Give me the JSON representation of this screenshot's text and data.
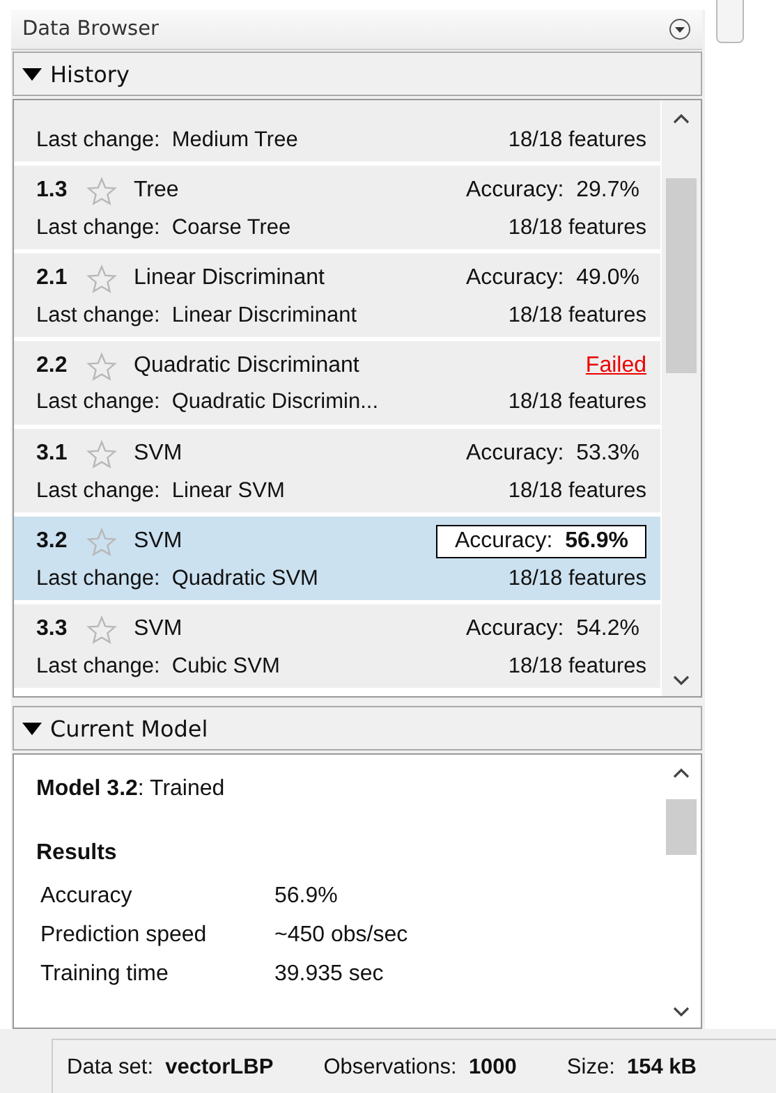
{
  "panel": {
    "title": "Data Browser"
  },
  "history": {
    "title": "History",
    "expanded": true,
    "rows": [
      {
        "kind": "partial",
        "change_label": "Last change:",
        "change": "Medium Tree",
        "features": "18/18 features",
        "selected": false
      },
      {
        "kind": "scored",
        "number": "1.3",
        "type": "Tree",
        "accuracy_label": "Accuracy:",
        "accuracy": "29.7%",
        "change_label": "Last change:",
        "change": "Coarse Tree",
        "features": "18/18 features",
        "selected": false
      },
      {
        "kind": "scored",
        "number": "2.1",
        "type": "Linear Discriminant",
        "accuracy_label": "Accuracy:",
        "accuracy": "49.0%",
        "change_label": "Last change:",
        "change": "Linear Discriminant",
        "features": "18/18 features",
        "selected": false
      },
      {
        "kind": "failed",
        "number": "2.2",
        "type": "Quadratic Discriminant",
        "status": "Failed",
        "change_label": "Last change:",
        "change": "Quadratic Discrimin...",
        "features": "18/18 features",
        "selected": false
      },
      {
        "kind": "scored",
        "number": "3.1",
        "type": "SVM",
        "accuracy_label": "Accuracy:",
        "accuracy": "53.3%",
        "change_label": "Last change:",
        "change": "Linear SVM",
        "features": "18/18 features",
        "selected": false
      },
      {
        "kind": "scored",
        "number": "3.2",
        "type": "SVM",
        "accuracy_label": "Accuracy:",
        "accuracy": "56.9%",
        "change_label": "Last change:",
        "change": "Quadratic SVM",
        "features": "18/18 features",
        "selected": true
      },
      {
        "kind": "scored",
        "number": "3.3",
        "type": "SVM",
        "accuracy_label": "Accuracy:",
        "accuracy": "54.2%",
        "change_label": "Last change:",
        "change": "Cubic SVM",
        "features": "18/18 features",
        "selected": false
      }
    ]
  },
  "current_model": {
    "title": "Current Model",
    "expanded": true,
    "heading": "**Model 3.2**: Trained",
    "results_title": "Results",
    "results": [
      {
        "label": "Accuracy",
        "value": "56.9%"
      },
      {
        "label": "Prediction speed",
        "value": "~450 obs/sec"
      },
      {
        "label": "Training time",
        "value": "39.935 sec"
      }
    ]
  },
  "status_bar": [
    {
      "label": "Data set:",
      "value": "vectorLBP"
    },
    {
      "label": "Observations:",
      "value": "1000"
    },
    {
      "label": "Size:",
      "value": "154 kB"
    }
  ]
}
